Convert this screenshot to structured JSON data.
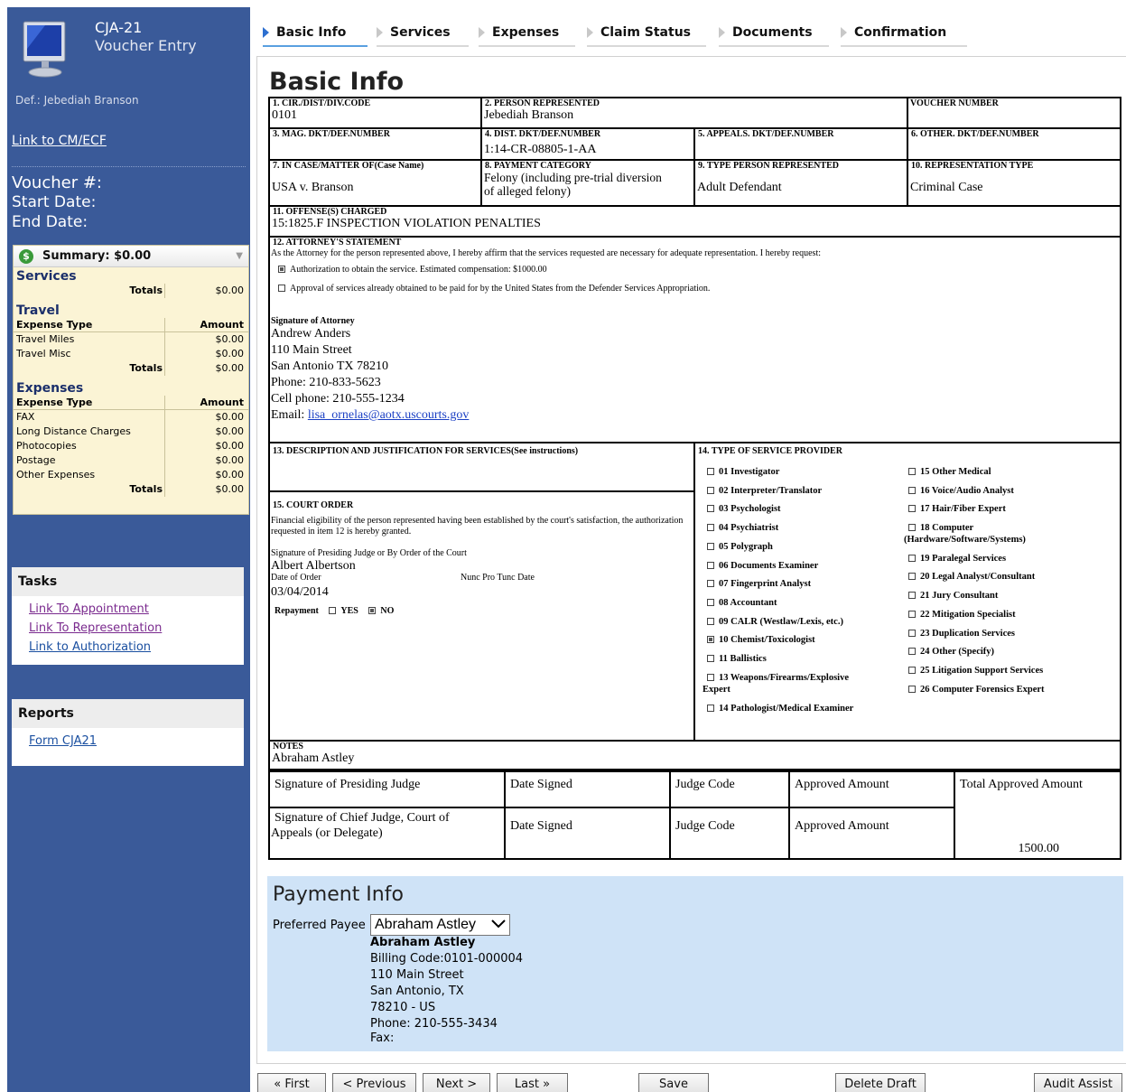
{
  "sidebar": {
    "form_code": "CJA-21",
    "form_name": "Voucher Entry",
    "defendant": "Def.: Jebediah Branson",
    "link_cmecf": "Link to CM/ECF",
    "voucher_label": "Voucher #:",
    "start_label": "Start Date:",
    "end_label": "End Date:",
    "summary": {
      "title": "Summary: $0.00",
      "services": {
        "title": "Services",
        "totals_label": "Totals",
        "totals": "$0.00"
      },
      "travel": {
        "title": "Travel",
        "col1": "Expense Type",
        "col2": "Amount",
        "rows": [
          {
            "label": "Travel Miles",
            "amount": "$0.00"
          },
          {
            "label": "Travel Misc",
            "amount": "$0.00"
          }
        ],
        "totals_label": "Totals",
        "totals": "$0.00"
      },
      "expenses": {
        "title": "Expenses",
        "col1": "Expense Type",
        "col2": "Amount",
        "rows": [
          {
            "label": "FAX",
            "amount": "$0.00"
          },
          {
            "label": "Long Distance Charges",
            "amount": "$0.00"
          },
          {
            "label": "Photocopies",
            "amount": "$0.00"
          },
          {
            "label": "Postage",
            "amount": "$0.00"
          },
          {
            "label": "Other Expenses",
            "amount": "$0.00"
          }
        ],
        "totals_label": "Totals",
        "totals": "$0.00"
      }
    },
    "tasks": {
      "title": "Tasks",
      "links": [
        "Link To Appointment",
        "Link To Representation",
        "Link to Authorization"
      ]
    },
    "reports": {
      "title": "Reports",
      "links": [
        "Form CJA21"
      ]
    }
  },
  "tabs": [
    "Basic Info",
    "Services",
    "Expenses",
    "Claim Status",
    "Documents",
    "Confirmation"
  ],
  "page_title": "Basic Info",
  "form": {
    "f1_label": "1. CIR./DIST/DIV.CODE",
    "f1_val": "0101",
    "f2_label": "2. PERSON REPRESENTED",
    "f2_val": "Jebediah Branson",
    "voucher_label": "VOUCHER NUMBER",
    "f3_label": "3. MAG. DKT/DEF.NUMBER",
    "f4_label": "4. DIST. DKT/DEF.NUMBER",
    "f4_val": "1:14-CR-08805-1-AA",
    "f5_label": "5. APPEALS. DKT/DEF.NUMBER",
    "f6_label": "6. OTHER. DKT/DEF.NUMBER",
    "f7_label": "7. IN CASE/MATTER OF(Case Name)",
    "f7_val": "USA v. Branson",
    "f8_label": "8. PAYMENT CATEGORY",
    "f8_val_1": "Felony (including pre-trial diversion",
    "f8_val_2": "of alleged felony)",
    "f9_label": "9. TYPE PERSON REPRESENTED",
    "f9_val": "Adult Defendant",
    "f10_label": "10. REPRESENTATION TYPE",
    "f10_val": "Criminal Case",
    "f11_label": "11. OFFENSE(S) CHARGED",
    "f11_val": "15:1825.F INSPECTION VIOLATION PENALTIES",
    "f12_label": "12. ATTORNEY'S STATEMENT",
    "f12_text": "As the Attorney for the person represented above, I hereby affirm that the services requested are necessary for adequate representation. I hereby request:",
    "f12_opt1": "Authorization to obtain the service. Estimated compensation: $1000.00",
    "f12_opt2": "Approval of services already obtained to be paid for by the United States from the Defender Services Appropriation.",
    "sig_label": "Signature of Attorney",
    "attorney_lines": [
      "Andrew Anders",
      "110 Main Street",
      "San Antonio TX 78210",
      "Phone: 210-833-5623",
      "Cell phone: 210-555-1234"
    ],
    "email_label": "Email:",
    "email": "lisa_ornelas@aotx.uscourts.gov",
    "f13_label": "13. DESCRIPTION AND JUSTIFICATION FOR SERVICES(See instructions)",
    "f14_label": "14. TYPE OF SERVICE PROVIDER",
    "f15_label": "15. COURT ORDER",
    "f15_text": "Financial eligibility of the person represented having been established by the court's satisfaction, the authorization requested in item 12 is hereby granted.",
    "judge_sig_label": "Signature of Presiding Judge or By Order of the Court",
    "judge_name": "Albert Albertson",
    "date_of_order_label": "Date of Order",
    "nunc_label": "Nunc Pro Tunc Date",
    "date_of_order": "03/04/2014",
    "repayment_label": "Repayment",
    "yes_label": "YES",
    "no_label": "NO",
    "providers_left": [
      "01 Investigator",
      "02 Interpreter/Translator",
      "03 Psychologist",
      "04 Psychiatrist",
      "05 Polygraph",
      "06 Documents Examiner",
      "07 Fingerprint Analyst",
      "08 Accountant",
      "09 CALR (Westlaw/Lexis, etc.)",
      "10 Chemist/Toxicologist",
      "11 Ballistics",
      "13 Weapons/Firearms/Explosive",
      "14 Pathologist/Medical Examiner"
    ],
    "weapons_cont": "Expert",
    "providers_right": [
      "15 Other Medical",
      "16 Voice/Audio Analyst",
      "17 Hair/Fiber Expert",
      "18 Computer",
      "19 Paralegal Services",
      "20 Legal Analyst/Consultant",
      "21 Jury Consultant",
      "22 Mitigation Specialist",
      "23 Duplication Services",
      "24 Other (Specify)",
      "25 Litigation Support Services",
      "26 Computer Forensics Expert"
    ],
    "computer_cont": "(Hardware/Software/Systems)",
    "notes_label": "NOTES",
    "notes_val": "Abraham Astley",
    "sig_presiding": "Signature of Presiding Judge",
    "date_signed": "Date Signed",
    "judge_code": "Judge Code",
    "approved_amount": "Approved Amount",
    "total_approved": "Total Approved Amount",
    "sig_chief_1": "Signature of Chief Judge, Court of",
    "sig_chief_2": "Appeals (or Delegate)",
    "total_value": "1500.00"
  },
  "payment": {
    "title": "Payment Info",
    "payee_label": "Preferred Payee",
    "payee_selected": "Abraham Astley",
    "name": "Abraham Astley",
    "lines": [
      "Billing Code:0101-000004",
      "110 Main Street",
      "San Antonio, TX",
      "78210 - US",
      "Phone: 210-555-3434",
      "Fax:"
    ]
  },
  "buttons": {
    "first": "« First",
    "previous": "< Previous",
    "next": "Next >",
    "last": "Last »",
    "save": "Save",
    "delete_draft": "Delete Draft",
    "audit_assist": "Audit Assist"
  },
  "colors": {
    "sidebar": "#3a5a99",
    "summary_bg": "#fbf4d5",
    "payment_bg": "#cfe3f7",
    "active_tab": "#2d6fd0"
  }
}
